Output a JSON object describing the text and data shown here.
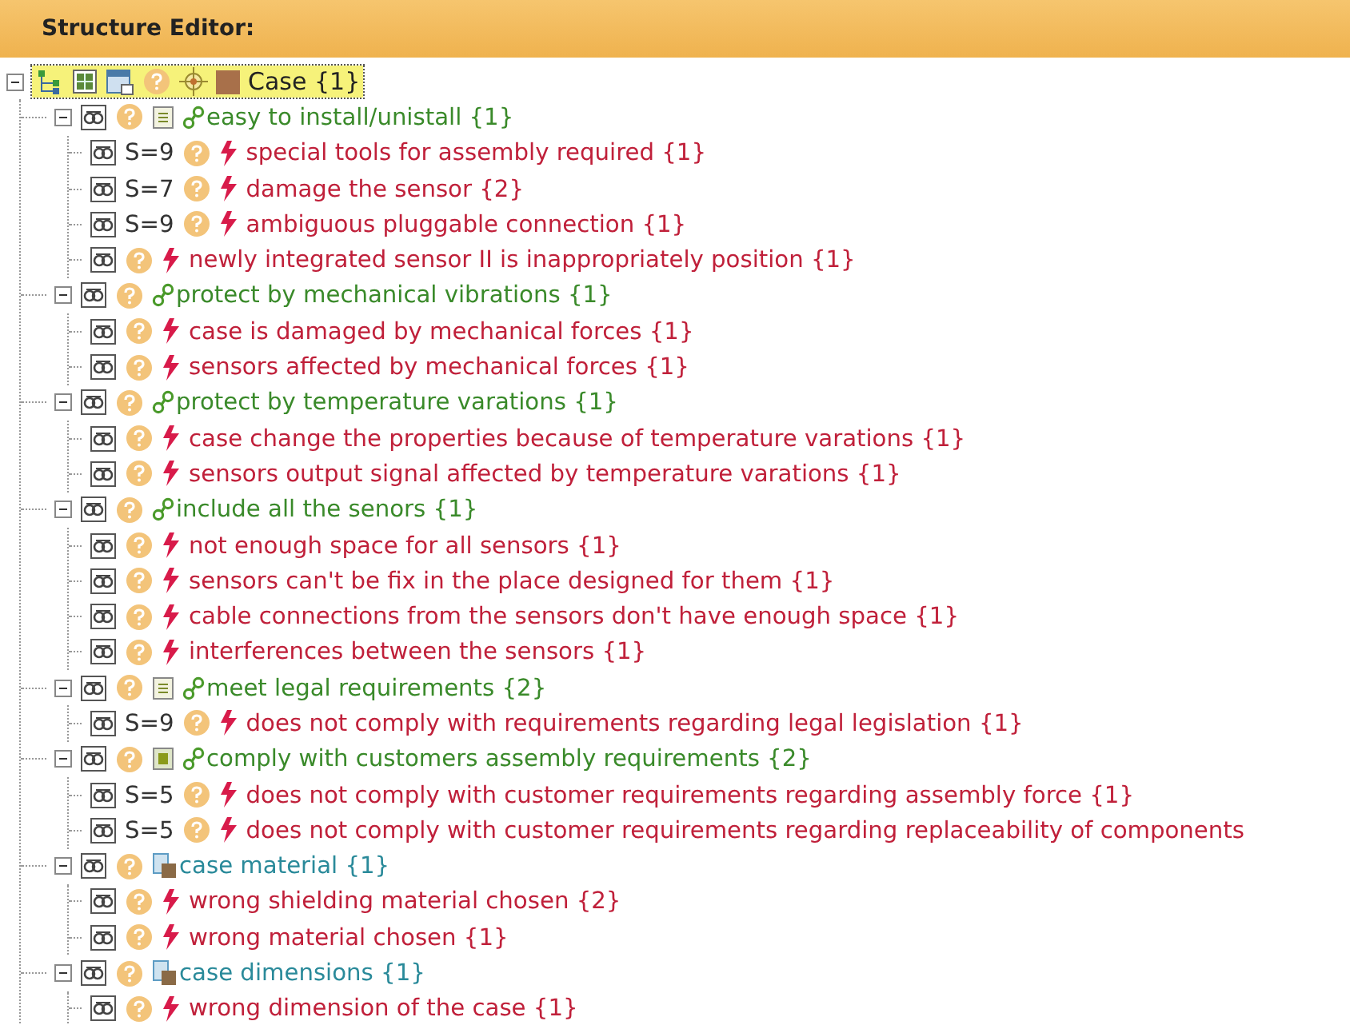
{
  "panel": {
    "title": "Structure Editor:"
  },
  "root": {
    "label": "Case {1}",
    "expanded": true,
    "selected": true,
    "children": [
      {
        "kind": "function",
        "label": "easy to install/unistall {1}",
        "expanded": true,
        "doc": true,
        "doc_filled": false,
        "children": [
          {
            "severity": "S=9",
            "label": "special tools for assembly required {1}"
          },
          {
            "severity": "S=7",
            "label": "damage the sensor {2}"
          },
          {
            "severity": "S=9",
            "label": "ambiguous pluggable connection {1}"
          },
          {
            "label": "newly integrated sensor II is inappropriately position {1}"
          }
        ]
      },
      {
        "kind": "function",
        "label": "protect by mechanical vibrations {1}",
        "expanded": true,
        "children": [
          {
            "label": "case is damaged by mechanical forces {1}"
          },
          {
            "label": "sensors affected by mechanical forces {1}"
          }
        ]
      },
      {
        "kind": "function",
        "label": "protect by temperature varations {1}",
        "expanded": true,
        "children": [
          {
            "label": "case change the properties because of temperature varations {1}"
          },
          {
            "label": "sensors output signal affected by temperature varations {1}"
          }
        ]
      },
      {
        "kind": "function",
        "label": "include all the senors {1}",
        "expanded": true,
        "children": [
          {
            "label": "not enough space for all sensors {1}"
          },
          {
            "label": "sensors can't be fix in the place designed for them {1}"
          },
          {
            "label": "cable connections from the sensors don't have enough space {1}"
          },
          {
            "label": "interferences between the sensors {1}"
          }
        ]
      },
      {
        "kind": "function",
        "label": "meet legal requirements {2}",
        "expanded": true,
        "doc": true,
        "doc_filled": false,
        "children": [
          {
            "severity": "S=9",
            "label": "does not comply with requirements regarding legal legislation {1}"
          }
        ]
      },
      {
        "kind": "function",
        "label": "comply with customers assembly requirements {2}",
        "expanded": true,
        "doc": true,
        "doc_filled": true,
        "children": [
          {
            "severity": "S=5",
            "label": "does not comply with customer requirements regarding assembly force {1}"
          },
          {
            "severity": "S=5",
            "label": "does not comply with customer requirements regarding replaceability of components"
          }
        ]
      },
      {
        "kind": "part",
        "label": "case material {1}",
        "expanded": true,
        "children": [
          {
            "label": "wrong shielding material chosen {2}"
          },
          {
            "label": "wrong material chosen {1}"
          }
        ]
      },
      {
        "kind": "part",
        "label": "case dimensions {1}",
        "expanded": true,
        "children": [
          {
            "label": "wrong dimension of the case {1}"
          }
        ]
      }
    ]
  }
}
